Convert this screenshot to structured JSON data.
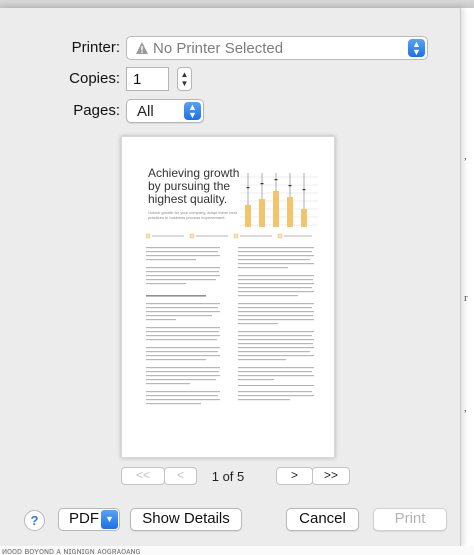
{
  "printer": {
    "label": "Printer:",
    "value": "No Printer Selected"
  },
  "copies": {
    "label": "Copies:",
    "value": "1"
  },
  "pages": {
    "label": "Pages:",
    "value": "All"
  },
  "preview": {
    "title": "Achieving growth by pursuing the highest quality.",
    "subtitle": "Unlock growth for your company, adopt these best practices in business process improvement."
  },
  "navigation": {
    "first": "<<",
    "prev": "<",
    "page_indicator": "1 of 5",
    "next": ">",
    "last": ">>"
  },
  "footer": {
    "help": "?",
    "pdf": "PDF",
    "show_details": "Show Details",
    "cancel": "Cancel",
    "print": "Print"
  },
  "colors": {
    "accent": "#1c70e8",
    "chart_fill": "#f2c46b"
  }
}
